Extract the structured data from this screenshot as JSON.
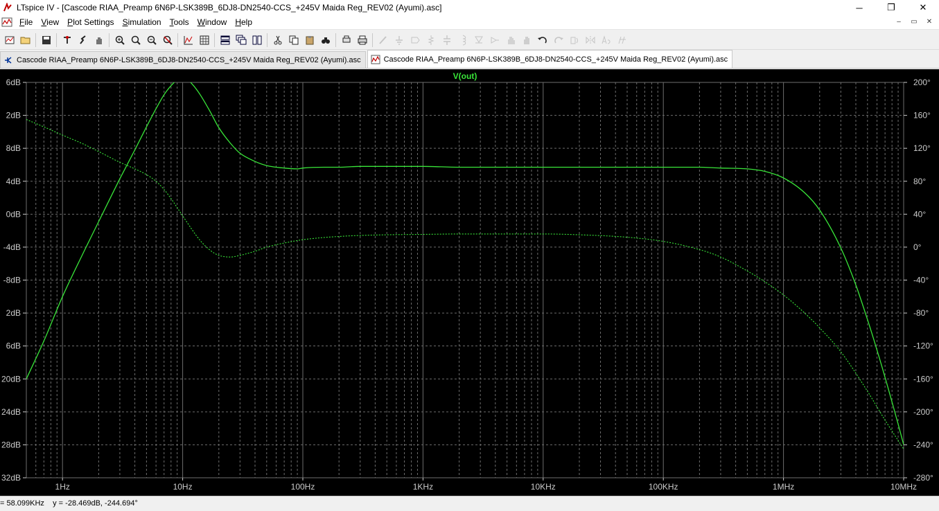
{
  "window": {
    "title": "LTspice IV - [Cascode RIAA_Preamp 6N6P-LSK389B_6DJ8-DN2540-CCS_+245V Maida Reg_REV02 (Ayumi).asc]",
    "minimize_label": "─",
    "maximize_label": "❐",
    "close_label": "✕"
  },
  "menubar": {
    "items": [
      {
        "underline": "F",
        "rest": "ile"
      },
      {
        "underline": "V",
        "rest": "iew"
      },
      {
        "underline": "P",
        "rest": "lot Settings"
      },
      {
        "underline": "S",
        "rest": "imulation"
      },
      {
        "underline": "T",
        "rest": "ools"
      },
      {
        "underline": "W",
        "rest": "indow"
      },
      {
        "underline": "H",
        "rest": "elp"
      }
    ],
    "mdi_min": "–",
    "mdi_restore": "▭",
    "mdi_close": "✕"
  },
  "toolbar": {
    "buttons": [
      {
        "name": "open-schematic",
        "enabled": true
      },
      {
        "name": "open-file",
        "enabled": true
      },
      {
        "name": "save",
        "enabled": true
      },
      {
        "name": "control-panel",
        "enabled": true
      },
      {
        "name": "run",
        "enabled": true
      },
      {
        "name": "halt",
        "enabled": true
      },
      {
        "name": "zoom-in",
        "enabled": true
      },
      {
        "name": "zoom-area",
        "enabled": true
      },
      {
        "name": "zoom-out",
        "enabled": true
      },
      {
        "name": "zoom-cancel",
        "enabled": true
      },
      {
        "name": "autorange",
        "enabled": true
      },
      {
        "name": "grid",
        "enabled": true
      },
      {
        "name": "tile-horizontal",
        "enabled": true
      },
      {
        "name": "cascade",
        "enabled": true
      },
      {
        "name": "tile-vertical",
        "enabled": true
      },
      {
        "name": "cut",
        "enabled": true
      },
      {
        "name": "copy",
        "enabled": true
      },
      {
        "name": "paste",
        "enabled": true
      },
      {
        "name": "find",
        "enabled": true
      },
      {
        "name": "print-setup",
        "enabled": true
      },
      {
        "name": "print",
        "enabled": true
      },
      {
        "name": "draw-wire",
        "enabled": false
      },
      {
        "name": "ground",
        "enabled": false
      },
      {
        "name": "label-net",
        "enabled": false
      },
      {
        "name": "resistor",
        "enabled": false
      },
      {
        "name": "capacitor",
        "enabled": false
      },
      {
        "name": "inductor",
        "enabled": false
      },
      {
        "name": "diode",
        "enabled": false
      },
      {
        "name": "component",
        "enabled": false
      },
      {
        "name": "move",
        "enabled": false
      },
      {
        "name": "drag",
        "enabled": false
      },
      {
        "name": "undo",
        "enabled": true
      },
      {
        "name": "redo",
        "enabled": false
      },
      {
        "name": "rotate",
        "enabled": false
      },
      {
        "name": "mirror",
        "enabled": false
      },
      {
        "name": "text",
        "enabled": false
      },
      {
        "name": "spice-directive",
        "enabled": false
      }
    ]
  },
  "tabs": [
    {
      "label": "Cascode RIAA_Preamp 6N6P-LSK389B_6DJ8-DN2540-CCS_+245V Maida Reg_REV02 (Ayumi).asc",
      "icon": "schematic-icon",
      "active": false
    },
    {
      "label": "Cascode RIAA_Preamp 6N6P-LSK389B_6DJ8-DN2540-CCS_+245V Maida Reg_REV02 (Ayumi).asc",
      "icon": "waveform-icon",
      "active": true
    }
  ],
  "chart_data": {
    "type": "line",
    "title": "V(out)",
    "xscale": "log",
    "xlim": [
      0.5,
      10000000
    ],
    "x_ticks": [
      {
        "value": 1,
        "label": "1Hz"
      },
      {
        "value": 10,
        "label": "10Hz"
      },
      {
        "value": 100,
        "label": "100Hz"
      },
      {
        "value": 1000,
        "label": "1KHz"
      },
      {
        "value": 10000,
        "label": "10KHz"
      },
      {
        "value": 100000,
        "label": "100KHz"
      },
      {
        "value": 1000000,
        "label": "1MHz"
      },
      {
        "value": 10000000,
        "label": "10MHz"
      }
    ],
    "y_left_ticks": [
      "6dB",
      "2dB",
      "8dB",
      "4dB",
      "0dB",
      "-4dB",
      "-8dB",
      "2dB",
      "6dB",
      "20dB",
      "24dB",
      "28dB",
      "32dB"
    ],
    "y_left_range_db": [
      -32,
      16
    ],
    "y_right_ticks": [
      "200°",
      "160°",
      "120°",
      "80°",
      "40°",
      "0°",
      "-40°",
      "-80°",
      "-120°",
      "-160°",
      "-200°",
      "-240°",
      "-280°"
    ],
    "y_right_range_deg": [
      -280,
      200
    ],
    "grid": true,
    "colors": {
      "background": "#000000",
      "grid": "#6e6e6e",
      "trace": "#39e639",
      "axis_text": "#cccccc",
      "title": "#39e639"
    },
    "series": [
      {
        "name": "V(out)",
        "quantity": "magnitude",
        "style": "solid",
        "axis": "left",
        "x": [
          0.5,
          0.7,
          1,
          1.5,
          2,
          3,
          4,
          5,
          6,
          7,
          8,
          9,
          10,
          11,
          12,
          14,
          17,
          20,
          25,
          30,
          40,
          50,
          70,
          90,
          100,
          150,
          200,
          300,
          500,
          1000,
          2000,
          5000,
          10000,
          20000,
          50000,
          100000,
          200000,
          300000,
          500000,
          700000,
          1000000,
          1500000,
          2000000,
          3000000,
          4000000,
          5000000,
          6000000,
          7000000,
          8000000,
          9000000,
          10000000
        ],
        "y": [
          -20,
          -15.4,
          -10,
          -4.6,
          -0.9,
          4.3,
          7.8,
          10.6,
          12.8,
          14.5,
          15.6,
          16.3,
          16.5,
          16.3,
          15.8,
          14.5,
          12.4,
          10.5,
          8.6,
          7.4,
          6.4,
          5.9,
          5.6,
          5.5,
          5.6,
          5.7,
          5.7,
          5.8,
          5.8,
          5.8,
          5.7,
          5.7,
          5.7,
          5.7,
          5.7,
          5.7,
          5.7,
          5.6,
          5.5,
          5.2,
          4.4,
          2.6,
          0.5,
          -4.1,
          -8.6,
          -12.8,
          -16.5,
          -19.8,
          -22.8,
          -25.5,
          -28
        ]
      },
      {
        "name": "V(out)",
        "quantity": "phase",
        "style": "dotted",
        "axis": "right",
        "x": [
          0.5,
          0.7,
          1,
          1.5,
          2,
          3,
          4,
          5,
          6,
          7,
          8,
          9,
          10,
          12,
          14,
          17,
          20,
          25,
          30,
          40,
          50,
          70,
          100,
          200,
          500,
          1000,
          2000,
          5000,
          10000,
          20000,
          50000,
          100000,
          200000,
          300000,
          500000,
          700000,
          1000000,
          1500000,
          2000000,
          3000000,
          5000000,
          7000000,
          10000000
        ],
        "y": [
          155,
          146,
          136,
          125,
          116,
          103,
          95,
          88,
          80,
          70,
          59,
          48,
          38,
          21,
          8,
          -4,
          -10,
          -12,
          -10,
          -5,
          0,
          5,
          9,
          13,
          15,
          15.5,
          16,
          16,
          16,
          15,
          12,
          7,
          -3,
          -12,
          -29,
          -42,
          -58,
          -80,
          -98,
          -127,
          -175,
          -210,
          -245
        ]
      }
    ],
    "cursor_readout": {
      "x": "58.099KHz",
      "y": "-28.469dB, -244.694°"
    }
  },
  "status": {
    "text": "= 58.099KHz    y = -28.469dB, -244.694°"
  }
}
